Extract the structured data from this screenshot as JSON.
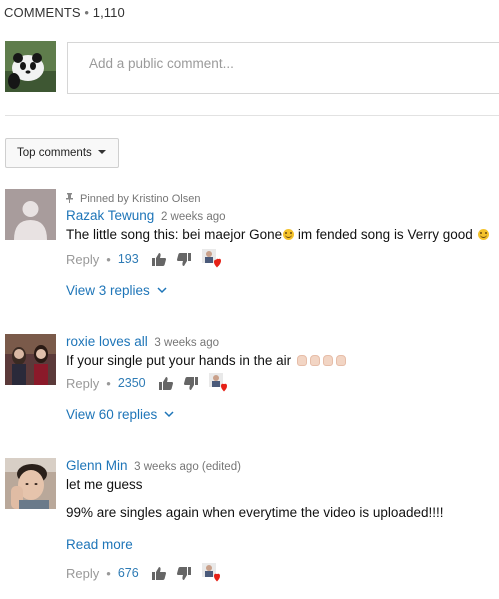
{
  "header": {
    "label": "COMMENTS",
    "separator": "•",
    "count": "1,110"
  },
  "comment_box": {
    "placeholder": "Add a public comment..."
  },
  "sort": {
    "label": "Top comments"
  },
  "comments": [
    {
      "pinned_text": "Pinned by Kristino Olsen",
      "author": "Razak Tewung",
      "time": "2 weeks ago",
      "text_part1": "The little song this: bei maejor Gone",
      "text_part2": " im fended song is Verry good",
      "reply_label": "Reply",
      "dot": "•",
      "likes": "193",
      "replies_label": "View 3 replies"
    },
    {
      "author": "roxie loves all",
      "time": "3 weeks ago",
      "text": "If your single put your hands in the air",
      "reply_label": "Reply",
      "dot": "•",
      "likes": "2350",
      "replies_label": "View 60 replies"
    },
    {
      "author": "Glenn Min",
      "time": "3 weeks ago (edited)",
      "text_line1": "let me guess",
      "text_line2": "99% are singles again when everytime the video is uploaded!!!!",
      "read_more": "Read more",
      "reply_label": "Reply",
      "dot": "•",
      "likes": "676"
    }
  ],
  "colors": {
    "link": "#1e75b8",
    "muted": "#767676",
    "heart": "#e62117"
  }
}
